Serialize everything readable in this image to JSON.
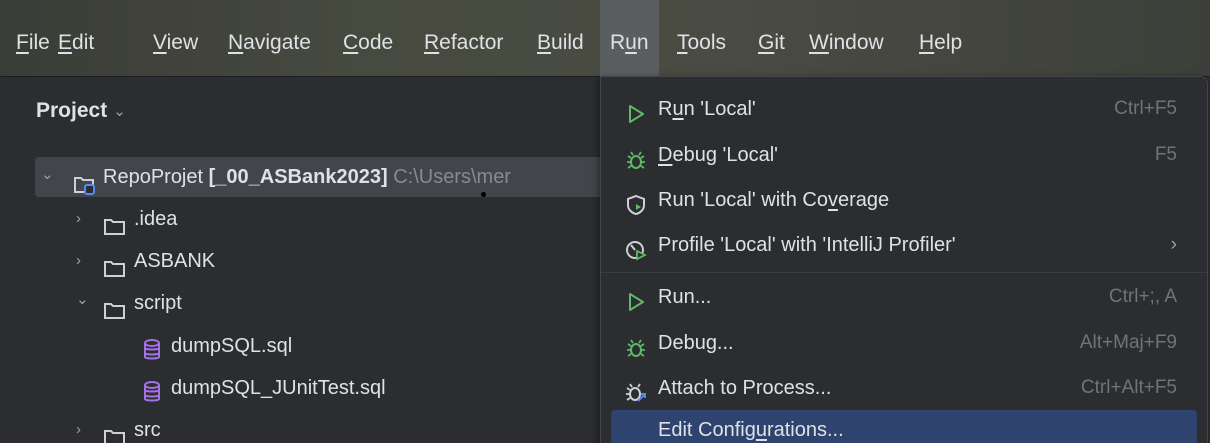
{
  "menubar": {
    "items": [
      {
        "pre": "",
        "u": "F",
        "post": "ile"
      },
      {
        "pre": "",
        "u": "E",
        "post": "dit"
      },
      {
        "pre": "",
        "u": "V",
        "post": "iew"
      },
      {
        "pre": "",
        "u": "N",
        "post": "avigate"
      },
      {
        "pre": "",
        "u": "C",
        "post": "ode"
      },
      {
        "pre": "",
        "u": "R",
        "post": "efactor"
      },
      {
        "pre": "",
        "u": "B",
        "post": "uild"
      },
      {
        "pre": "R",
        "u": "u",
        "post": "n"
      },
      {
        "pre": "",
        "u": "T",
        "post": "ools"
      },
      {
        "pre": "",
        "u": "G",
        "post": "it"
      },
      {
        "pre": "",
        "u": "W",
        "post": "indow"
      },
      {
        "pre": "",
        "u": "H",
        "post": "elp"
      }
    ]
  },
  "project": {
    "title": "Project",
    "root": {
      "name": "RepoProjet",
      "module": "[_00_ASBank2023]",
      "path": "C:\\Users\\mer"
    },
    "children": [
      ".idea",
      "ASBANK",
      "script"
    ],
    "script_children": [
      "dumpSQL.sql",
      "dumpSQL_JUnitTest.sql"
    ],
    "last": "src"
  },
  "run_menu": {
    "run_local": {
      "pre": "R",
      "u": "u",
      "post": "n 'Local'",
      "shortcut": "Ctrl+F5"
    },
    "debug_local": {
      "pre": "",
      "u": "D",
      "post": "ebug 'Local'",
      "shortcut": "F5"
    },
    "coverage": {
      "pre": "Run 'Local' with Co",
      "u": "v",
      "post": "erage"
    },
    "profile": {
      "label": "Profile 'Local' with 'IntelliJ Profiler'"
    },
    "run": {
      "label": "Run...",
      "shortcut": "Ctrl+;, A"
    },
    "debug": {
      "label": "Debug...",
      "shortcut": "Alt+Maj+F9"
    },
    "attach": {
      "label": "Attach to Process...",
      "shortcut": "Ctrl+Alt+F5"
    },
    "edit_config": {
      "pre": "Edit Config",
      "u": "u",
      "post": "rations..."
    }
  },
  "colors": {
    "accent": "#2e436e",
    "run_green": "#5fb865",
    "db_purple": "#a571e6"
  }
}
